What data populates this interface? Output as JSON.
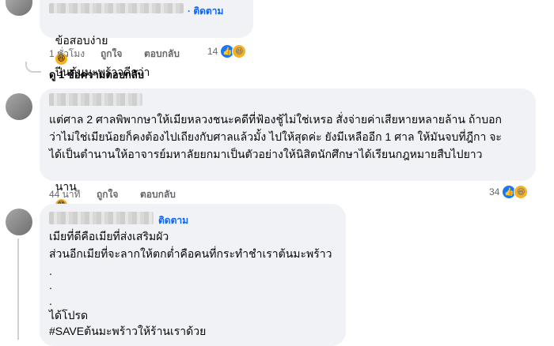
{
  "comment1": {
    "follow_label": "· ติดตาม",
    "text": "ข้อสอบง่าย",
    "text2": "ปีนต้นมะพร้าวดีกว่า",
    "time": "1 ชั่วโมง",
    "like": "ถูกใจ",
    "reply": "ตอบกลับ",
    "reaction_count": "14",
    "view_replies": "ดู 1 ข้อความตอบกลับ"
  },
  "comment2": {
    "lines": [
      "แต่ศาล 2 ศาลพิพากษาให้เมียหลวงชนะคดีที่ฟ้องชู้ไม่ใช่เหรอ สั่งจ่ายค่าเสียหายหลายล้าน ถ้าบอก",
      "ว่าไม่ใช่เมียน้อยก็คงต้องไปเถียงกับศาลแล้วมั้ง ไปให้สุดค่ะ ยังมีเหลืออีก 1 ศาล ให้มันจบที่ฎีกา จะ",
      "ได้เป็นตำนานให้อาจารย์มหาลัยยกมาเป็นตัวอย่างให้นิสิตนักศึกษาได้เรียนกฎหมายสืบไปยาว",
      "นาน"
    ],
    "time": "44 นาที",
    "like": "ถูกใจ",
    "reply": "ตอบกลับ",
    "reaction_count": "34"
  },
  "comment3": {
    "follow_label": "ติดตาม",
    "lines": [
      "เมียที่ดีคือเมียที่ส่งเสริมผัว",
      "ส่วนอีกเมียที่จะลากให้ตกต่ำคือคนที่กระทำชำเราต้นมะพร้าว",
      ".",
      ".",
      ".",
      "ได้โปรด",
      "#SAVEต้นมะพร้าวให้ร้านเราด้วย"
    ]
  }
}
